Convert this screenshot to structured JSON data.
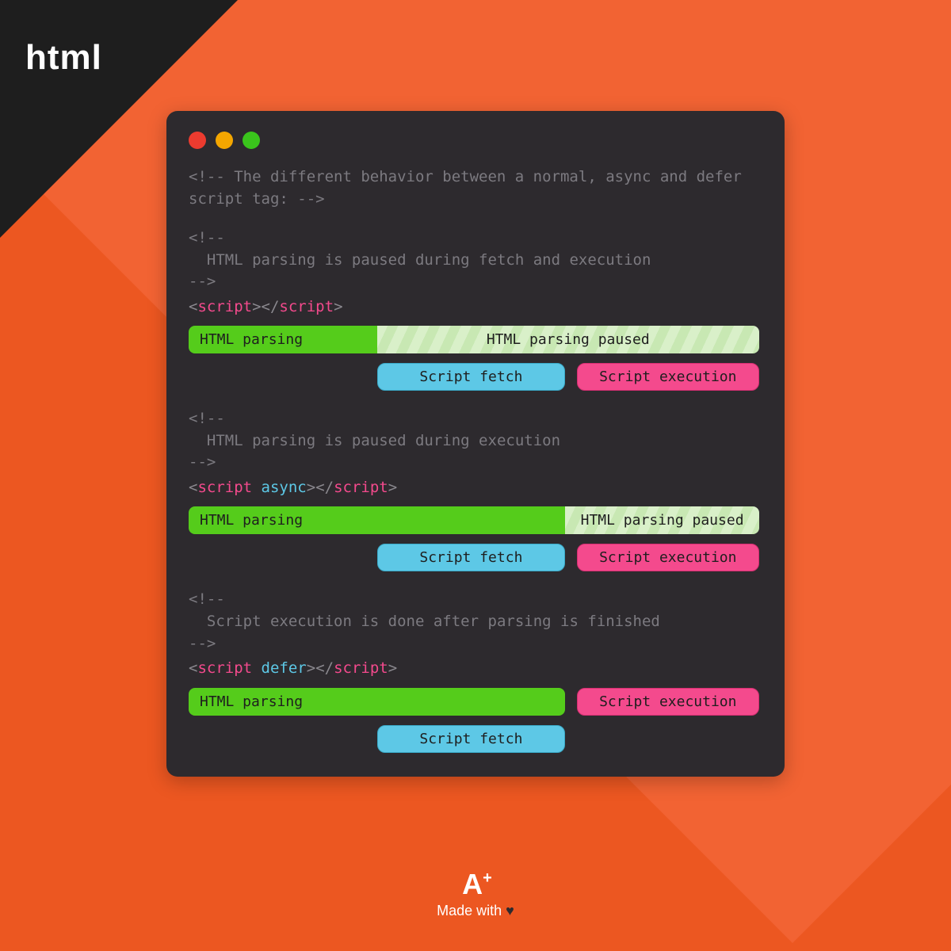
{
  "brand": {
    "corner_label": "html"
  },
  "window_dots": [
    "red",
    "yellow",
    "green"
  ],
  "intro_comment": "<!-- The different behavior between a normal, async and defer script tag: -->",
  "sections": [
    {
      "comment": "<!--\n  HTML parsing is paused during fetch and execution\n-->",
      "tag_open": "<",
      "tag_name": "script",
      "tag_close_open": "></",
      "tag_close": ">",
      "attr": "",
      "parsing_label": "HTML parsing",
      "paused_label": "HTML parsing paused",
      "parsing_pct": 33,
      "paused_pct": 67,
      "fetch_label": "Script fetch",
      "fetch_left_pct": 33,
      "fetch_width_pct": 33,
      "exec_label": "Script execution",
      "exec_left_pct": 68,
      "exec_width_pct": 32
    },
    {
      "comment": "<!--\n  HTML parsing is paused during execution\n-->",
      "tag_open": "<",
      "tag_name": "script",
      "tag_close_open": "></",
      "tag_close": ">",
      "attr": "async",
      "parsing_label": "HTML parsing",
      "paused_label": "HTML parsing paused",
      "parsing_pct": 66,
      "paused_pct": 34,
      "fetch_label": "Script fetch",
      "fetch_left_pct": 33,
      "fetch_width_pct": 33,
      "exec_label": "Script execution",
      "exec_left_pct": 68,
      "exec_width_pct": 32
    },
    {
      "comment": "<!--\n  Script execution is done after parsing is finished\n-->",
      "tag_open": "<",
      "tag_name": "script",
      "tag_close_open": "></",
      "tag_close": ">",
      "attr": "defer",
      "parsing_label": "HTML parsing",
      "paused_label": "",
      "parsing_pct": 66,
      "paused_pct": 0,
      "fetch_label": "Script fetch",
      "fetch_left_pct": 33,
      "fetch_width_pct": 33,
      "exec_label": "Script execution",
      "exec_left_pct": 68,
      "exec_width_pct": 32,
      "exec_same_row_as_parsing": true
    }
  ],
  "footer": {
    "logo_main": "A",
    "logo_plus": "+",
    "tagline_prefix": "Made with ",
    "heart": "♥"
  }
}
